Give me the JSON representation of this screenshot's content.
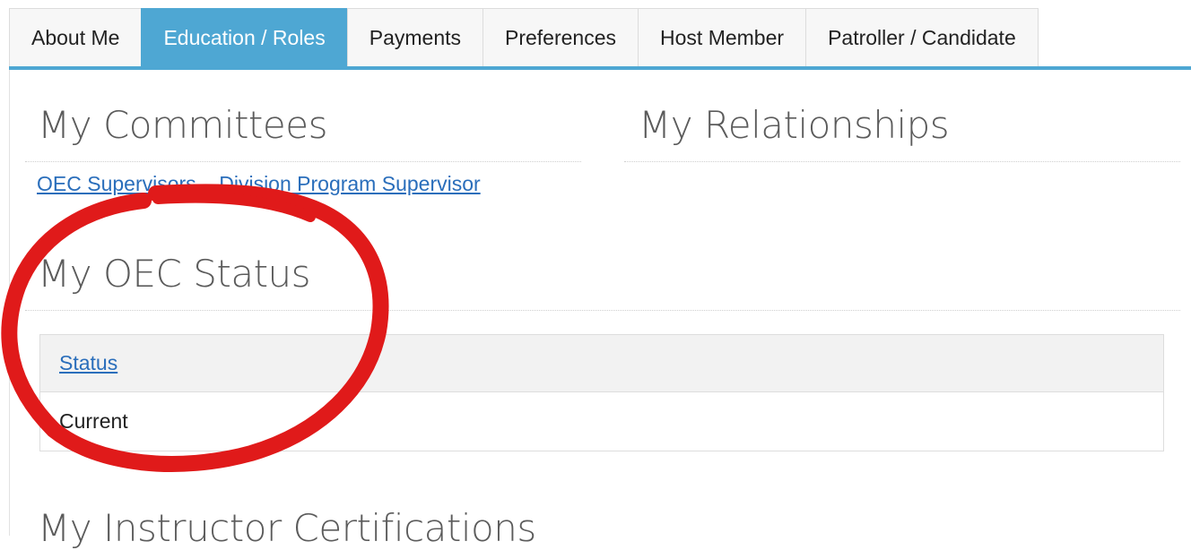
{
  "tabs": [
    {
      "label": "About Me",
      "active": false
    },
    {
      "label": "Education / Roles",
      "active": true
    },
    {
      "label": "Payments",
      "active": false
    },
    {
      "label": "Preferences",
      "active": false
    },
    {
      "label": "Host Member",
      "active": false
    },
    {
      "label": "Patroller / Candidate",
      "active": false
    }
  ],
  "committees": {
    "title": "My Committees",
    "items": [
      {
        "label": "OEC Supervisors – Division Program Supervisor"
      }
    ]
  },
  "relationships": {
    "title": "My Relationships"
  },
  "oec_status": {
    "title": "My OEC Status",
    "column_header": "Status",
    "rows": [
      {
        "status": "Current"
      }
    ]
  },
  "instructor_certifications": {
    "title": "My Instructor Certifications"
  },
  "colors": {
    "accent": "#4ea7d3",
    "link": "#2a6ebb",
    "annotation": "#e01a1a"
  },
  "annotation": {
    "shape": "hand-drawn-circle",
    "target": "My OEC Status"
  }
}
